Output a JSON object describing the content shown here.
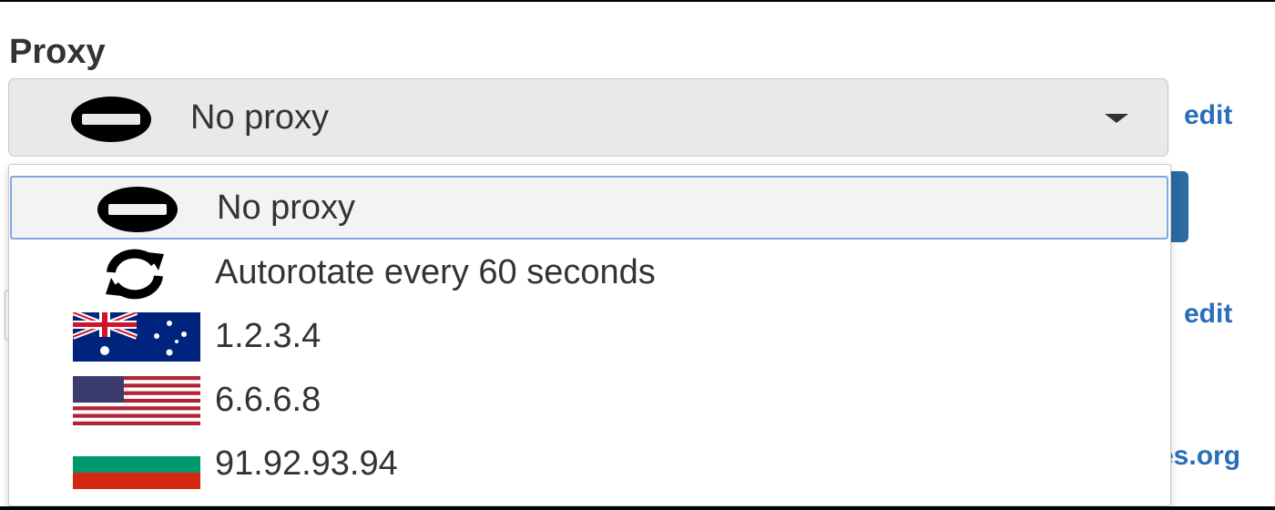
{
  "proxy": {
    "label": "Proxy",
    "selected_value": "No proxy",
    "selected_icon": "no-entry-icon"
  },
  "side_links": {
    "edit_1": "edit",
    "edit_2": "edit",
    "partial_link": "es.org"
  },
  "dropdown": {
    "options": [
      {
        "label": "No proxy",
        "icon": "no-entry-icon",
        "selected": true
      },
      {
        "label": "Autorotate every 60 seconds",
        "icon": "refresh-icon",
        "selected": false
      },
      {
        "label": "1.2.3.4",
        "icon": "australia-flag-icon",
        "selected": false
      },
      {
        "label": "6.6.6.8",
        "icon": "usa-flag-icon",
        "selected": false
      },
      {
        "label": "91.92.93.94",
        "icon": "bulgaria-flag-icon",
        "selected": false
      }
    ]
  },
  "colors": {
    "link": "#2a6ebb",
    "select_bg": "#e9e9e9",
    "highlight_border": "#7fa8e0",
    "button_blue": "#2c6aa3"
  }
}
